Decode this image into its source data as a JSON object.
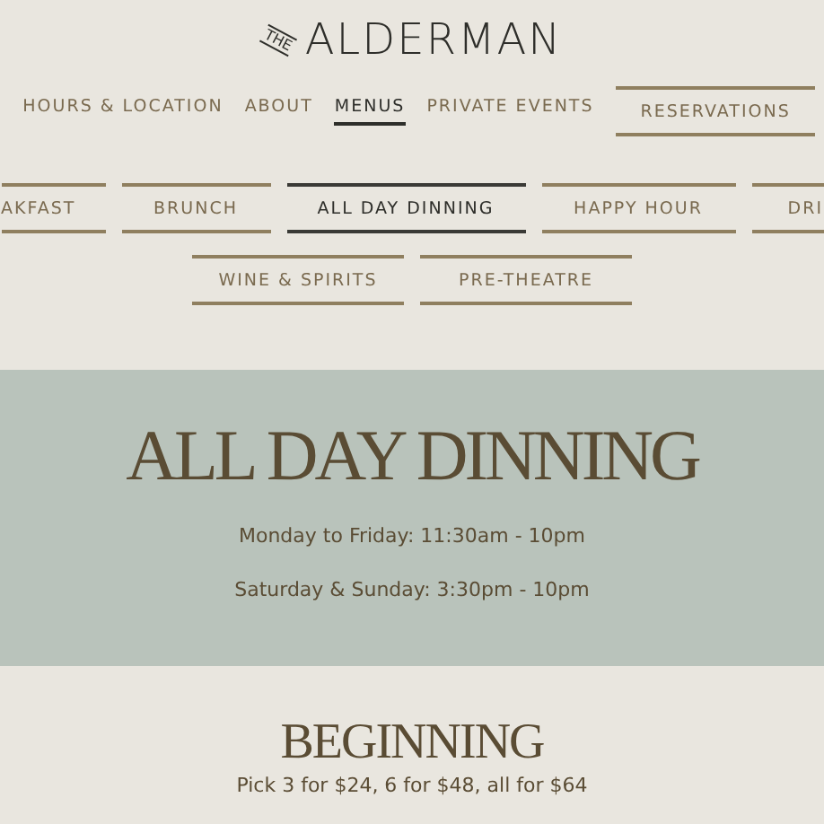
{
  "logo": {
    "small": "THE",
    "name": "ALDERMAN"
  },
  "nav": [
    {
      "label": "HOURS & LOCATION",
      "selected": false,
      "kind": "link"
    },
    {
      "label": "ABOUT",
      "selected": false,
      "kind": "link"
    },
    {
      "label": "MENUS",
      "selected": true,
      "kind": "link"
    },
    {
      "label": "PRIVATE EVENTS",
      "selected": false,
      "kind": "link"
    },
    {
      "label": "RESERVATIONS",
      "selected": false,
      "kind": "button"
    }
  ],
  "menu_tabs": [
    [
      {
        "label": "AKFAST",
        "selected": false
      },
      {
        "label": "BRUNCH",
        "selected": false
      },
      {
        "label": "ALL DAY DINNING",
        "selected": true
      },
      {
        "label": "HAPPY HOUR",
        "selected": false
      },
      {
        "label": "DRI",
        "selected": false
      }
    ],
    [
      {
        "label": "WINE & SPIRITS",
        "selected": false
      },
      {
        "label": "PRE-THEATRE",
        "selected": false
      }
    ]
  ],
  "hero": {
    "title": "ALL DAY DINNING",
    "hours": [
      "Monday to Friday: 11:30am - 10pm",
      "Saturday & Sunday: 3:30pm - 10pm"
    ]
  },
  "section": {
    "title": "BEGINNING",
    "subtitle": "Pick 3 for $24, 6 for $48, all for $64"
  }
}
